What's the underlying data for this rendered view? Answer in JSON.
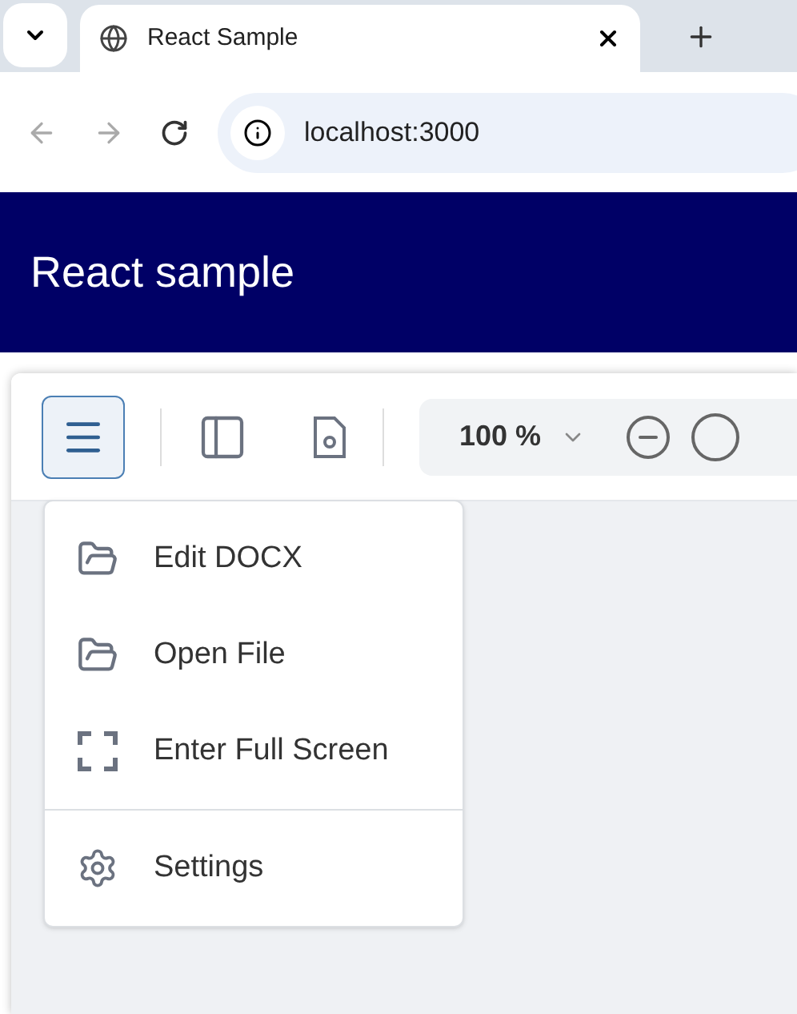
{
  "browser": {
    "tab": {
      "title": "React Sample"
    },
    "address": "localhost:3000"
  },
  "header": {
    "title": "React sample"
  },
  "toolbar": {
    "menu_button": {
      "pressed": true
    },
    "zoom": "100 %"
  },
  "menu": {
    "groups": [
      [
        {
          "kind": "folder",
          "label": "Edit DOCX"
        },
        {
          "kind": "folder",
          "label": "Open File"
        },
        {
          "kind": "fullscreen",
          "label": "Enter Full Screen"
        }
      ],
      [
        {
          "kind": "settings",
          "label": "Settings"
        }
      ]
    ]
  }
}
